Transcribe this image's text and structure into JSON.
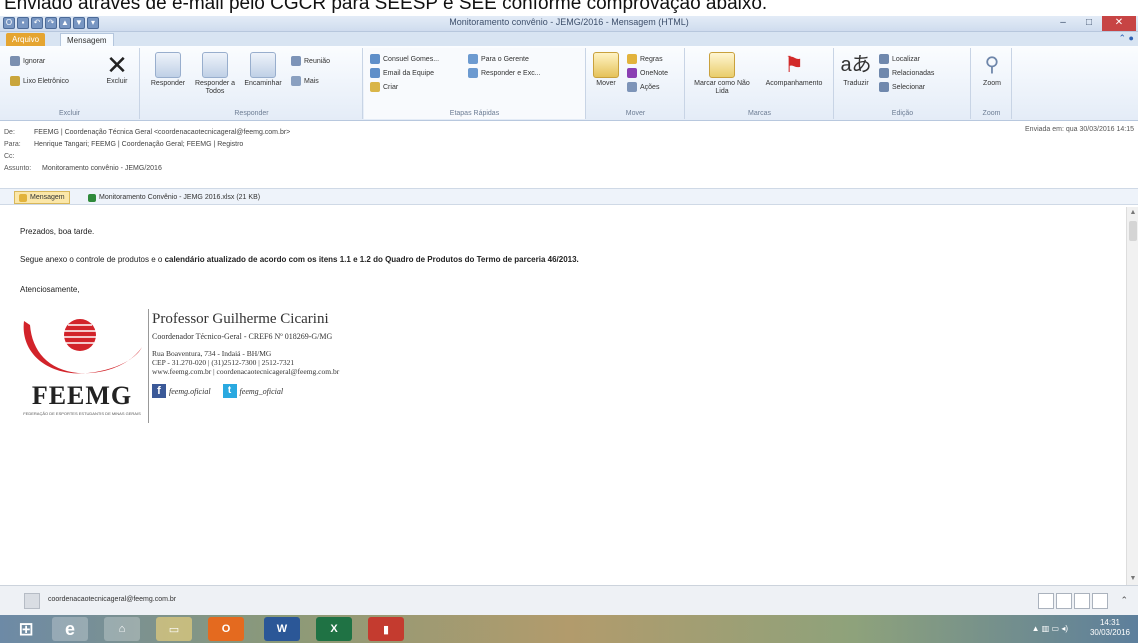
{
  "caption": "Enviado através de e-mail pelo CGCR  para SEESP e SEE conforme comprovação abaixo.",
  "window": {
    "title": "Monitoramento convênio - JEMG/2016 - Mensagem (HTML)",
    "help": "? ",
    "min": "–",
    "max": "□",
    "close": "✕"
  },
  "tabs": {
    "file": "Arquivo",
    "message": "Mensagem"
  },
  "ribbon": {
    "excluir": {
      "ignore": "Ignorar",
      "junk": "Lixo Eletrônico",
      "delete": "Excluir",
      "label": "Excluir"
    },
    "responder": {
      "reply": "Responder",
      "reply_all": "Responder a Todos",
      "forward": "Encaminhar",
      "meeting": "Reunião",
      "more": "Mais",
      "label": "Responder"
    },
    "quick": {
      "s1": "Consuel Gomes...",
      "s2": "Email da Equipe",
      "s3": "Criar",
      "s4": "Para o Gerente",
      "s5": "Responder e Exc...",
      "label": "Etapas Rápidas"
    },
    "mover": {
      "move": "Mover",
      "rules": "Regras",
      "onenote": "OneNote",
      "actions": "Ações",
      "label": "Mover"
    },
    "marcas": {
      "unread": "Marcar como Não Lida",
      "followup": "Acompanhamento",
      "label": "Marcas"
    },
    "edicao": {
      "translate": "Traduzir",
      "find": "Localizar",
      "related": "Relacionadas",
      "select": "Selecionar",
      "label": "Edição"
    },
    "zoom": {
      "zoom": "Zoom",
      "label": "Zoom"
    }
  },
  "header": {
    "from_label": "De:",
    "from": "FEEMG | Coordenação Técnica Geral <coordenacaotecnicageral@feemg.com.br>",
    "to_label": "Para:",
    "to": "Henrique Tangari; FEEMG | Coordenação Geral; FEEMG | Registro",
    "cc_label": "Cc:",
    "cc": "",
    "subject_label": "Assunto:",
    "subject": "Monitoramento convênio - JEMG/2016",
    "sent": "Enviada em:  qua 30/03/2016 14:15"
  },
  "attachments": {
    "message": "Mensagem",
    "file": "Monitoramento Convênio - JEMG 2016.xlsx (21 KB)"
  },
  "body": {
    "greeting": "Prezados, boa tarde.",
    "p1_a": "Segue anexo o controle de produtos e o ",
    "p1_b": "calendário atualizado de acordo com os itens 1.1 e 1.2 do Quadro de Produtos do Termo de parceria 46/2013.",
    "closing": "Atenciosamente,"
  },
  "signature": {
    "logo_text": "FEEMG",
    "logo_sub": "FEDERAÇÃO DE ESPORTES ESTUDANTIS DE MINAS GERAIS",
    "name": "Professor Guilherme Cicarini",
    "role": "Coordenador Técnico-Geral - CREF6 Nº 018269-G/MG",
    "addr1": "Rua Boaventura, 734 - Indaiá - BH/MG",
    "addr2": "CEP - 31.270-020 | (31)2512-7300 | 2512-7321",
    "web": "www.feemg.com.br | coordenacaotecnicageral@feemg.com.br",
    "facebook": "feemg.oficial",
    "twitter": "feemg_oficial"
  },
  "status": {
    "email": "coordenacaotecnicageral@feemg.com.br"
  },
  "taskbar": {
    "time": "14:31",
    "date": "30/03/2016"
  },
  "colors": {
    "accent": "#e5a531",
    "logo_red": "#d2232a",
    "link": "#1a4f9c"
  }
}
